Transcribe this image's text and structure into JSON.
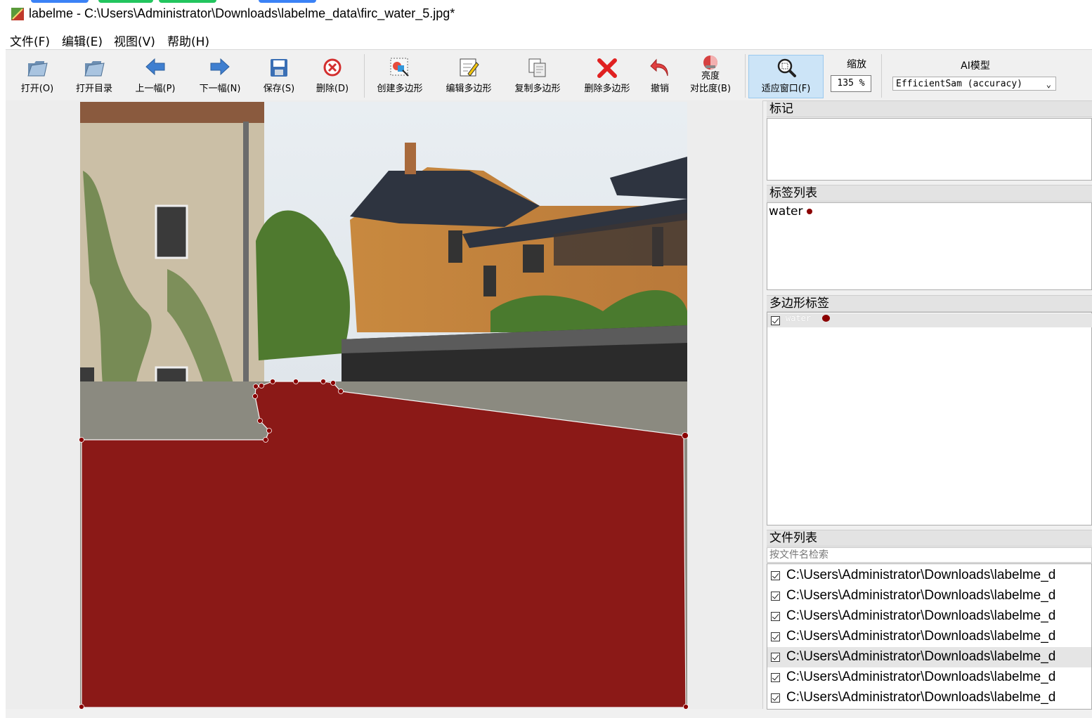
{
  "window": {
    "title": "labelme - C:\\Users\\Administrator\\Downloads\\labelme_data\\firc_water_5.jpg*"
  },
  "menu": [
    {
      "label": "文件(F)"
    },
    {
      "label": "编辑(E)"
    },
    {
      "label": "视图(V)"
    },
    {
      "label": "帮助(H)"
    }
  ],
  "toolbar": {
    "open": "打开(O)",
    "open_dir": "打开目录",
    "prev": "上一幅(P)",
    "next": "下一幅(N)",
    "save": "保存(S)",
    "delete": "删除(D)",
    "create_polygon": "创建多边形",
    "edit_polygon": "编辑多边形",
    "copy_polygon": "复制多边形",
    "delete_polygon": "删除多边形",
    "undo": "撤销",
    "brightness_line1": "亮度",
    "brightness_line2": "对比度(B)",
    "fit_window": "适应窗口(F)",
    "zoom_label": "缩放",
    "zoom_value": "135 %",
    "ai_label": "AI模型",
    "ai_model": "EfficientSam (accuracy)"
  },
  "icons": {
    "open": "folder-open-icon",
    "open_dir": "folder-open-icon",
    "prev": "arrow-left-icon",
    "next": "arrow-right-icon",
    "save": "floppy-disk-icon",
    "delete": "delete-circle-icon",
    "create_polygon": "create-polygon-icon",
    "edit_polygon": "edit-polygon-icon",
    "copy_polygon": "copy-polygon-icon",
    "delete_polygon": "red-x-icon",
    "undo": "undo-arrow-icon",
    "brightness": "brightness-contrast-icon",
    "fit_window": "zoom-fit-icon"
  },
  "dock": {
    "flags_title": "标记",
    "label_list_title": "标签列表",
    "labels": [
      {
        "name": "water",
        "color": "#8b0000"
      }
    ],
    "polygon_labels_title": "多边形标签",
    "polygons": [
      {
        "name": "water",
        "checked": true,
        "color": "#8b0000"
      }
    ],
    "file_list_title": "文件列表",
    "file_search_placeholder": "按文件名检索",
    "files": [
      "C:\\Users\\Administrator\\Downloads\\labelme_d",
      "C:\\Users\\Administrator\\Downloads\\labelme_d",
      "C:\\Users\\Administrator\\Downloads\\labelme_d",
      "C:\\Users\\Administrator\\Downloads\\labelme_d",
      "C:\\Users\\Administrator\\Downloads\\labelme_d",
      "C:\\Users\\Administrator\\Downloads\\labelme_d",
      "C:\\Users\\Administrator\\Downloads\\labelme_d"
    ]
  },
  "colors": {
    "polygon_fill": "#8b0000",
    "fit_window_highlight": "#cce4f7"
  }
}
